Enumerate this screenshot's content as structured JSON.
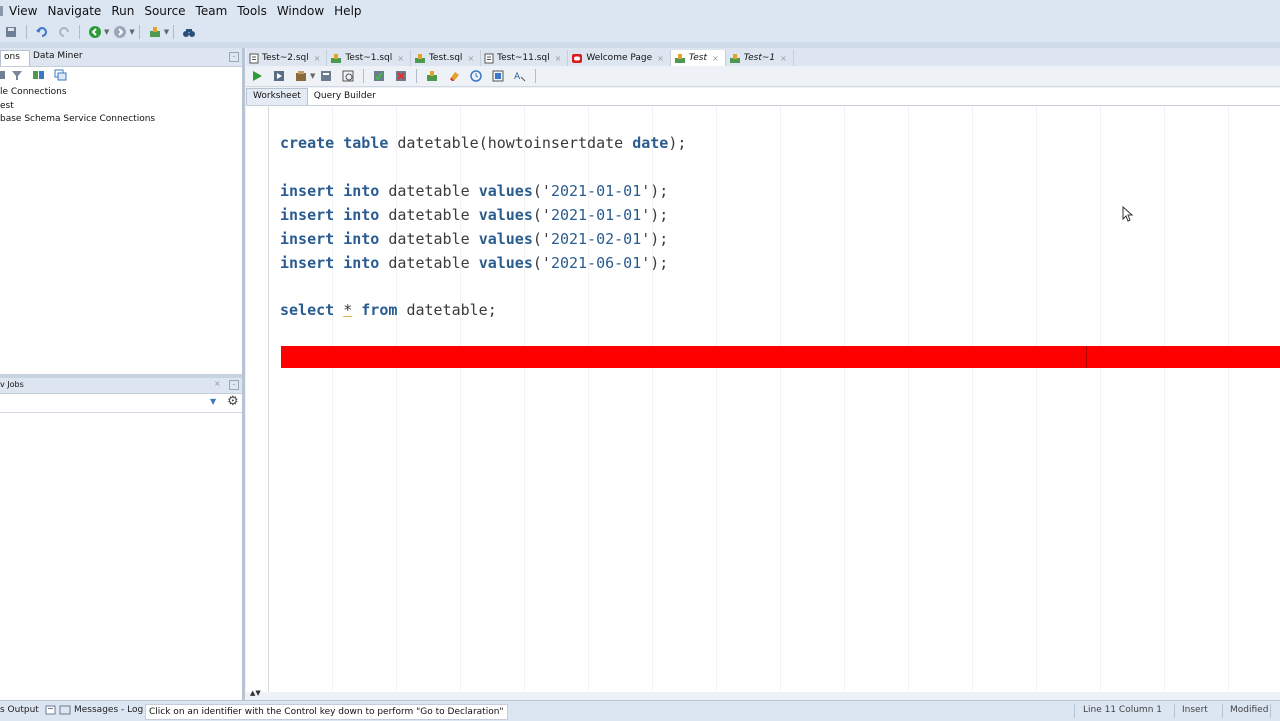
{
  "menu": [
    "View",
    "Navigate",
    "Run",
    "Source",
    "Team",
    "Tools",
    "Window",
    "Help"
  ],
  "left_panel": {
    "tabs": [
      "ons",
      "Data Miner"
    ],
    "tree": [
      "le Connections",
      "est",
      "base Schema Service Connections"
    ],
    "jobs_header": "v Jobs"
  },
  "editor_tabs": [
    {
      "label": "Test~2.sql",
      "icon": "sql-file-icon",
      "italic": false,
      "active": false
    },
    {
      "label": "Test~1.sql",
      "icon": "sql-file-icon",
      "italic": false,
      "active": false
    },
    {
      "label": "Test.sql",
      "icon": "sql-file-icon",
      "italic": false,
      "active": false
    },
    {
      "label": "Test~11.sql",
      "icon": "sql-file-icon",
      "italic": false,
      "active": false
    },
    {
      "label": "Welcome Page",
      "icon": "oracle-icon",
      "italic": false,
      "active": false
    },
    {
      "label": "Test",
      "icon": "connection-icon",
      "italic": true,
      "active": true
    },
    {
      "label": "Test~1",
      "icon": "connection-icon",
      "italic": true,
      "active": false
    }
  ],
  "sub_tabs": [
    "Worksheet",
    "Query Builder"
  ],
  "code": {
    "create_kw1": "create",
    "create_kw2": "table",
    "create_name": "datetable",
    "create_col": "howtoinsertdate",
    "create_type": "date",
    "insert_values": [
      "2021-01-01",
      "2021-01-01",
      "2021-02-01",
      "2021-06-01"
    ],
    "insert_kw1": "insert",
    "insert_kw2": "into",
    "insert_table": "datetable",
    "insert_kw3": "values",
    "select_kw": "select",
    "select_star": "*",
    "select_from": "from",
    "select_table": "datetable"
  },
  "status": {
    "output_tab": "s Output",
    "messages_tab": "Messages - Log",
    "message": "Click on an identifier with the Control key down to perform \"Go to Declaration\"",
    "position": "Line 11 Column 1",
    "mode": "Insert",
    "state": "Modified"
  },
  "colors": {
    "keyword": "#2a5c8f",
    "current_line": "#ff0000",
    "chrome": "#dce6f2"
  }
}
